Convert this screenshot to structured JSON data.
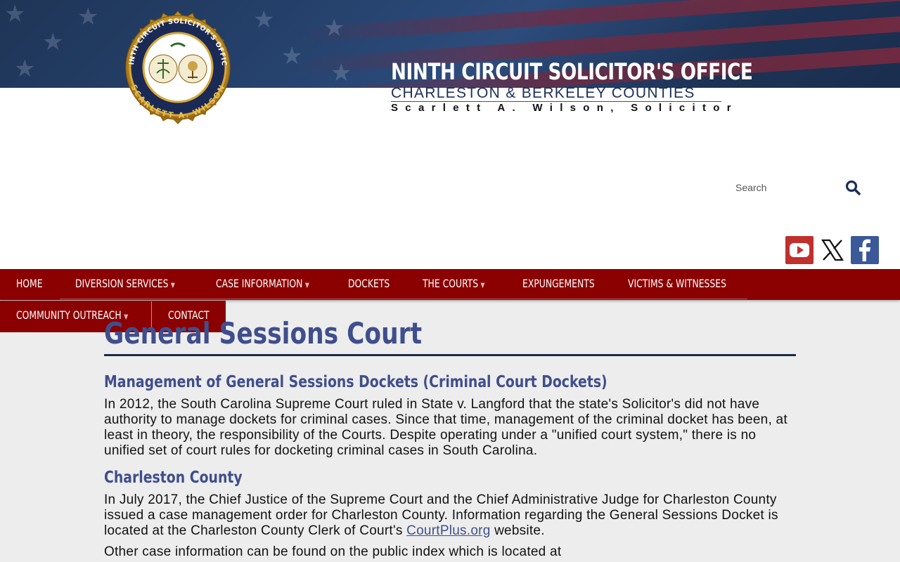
{
  "header": {
    "title": "NINTH CIRCUIT SOLICITOR'S OFFICE",
    "subtitle": "CHARLESTON & BERKELEY COUNTIES",
    "solicitor": "Scarlett A. Wilson, Solicitor",
    "seal": {
      "ring_text_top": "NINTH CIRCUIT SOLICITOR'S OFFICE",
      "ring_text_bottom": "SCARLETT A. WILSON"
    }
  },
  "search": {
    "placeholder": "Search"
  },
  "social": [
    {
      "name": "YouTube",
      "icon": "youtube-icon",
      "color": "#c0302d"
    },
    {
      "name": "X",
      "icon": "x-icon",
      "color": "#111111"
    },
    {
      "name": "Facebook",
      "icon": "facebook-icon",
      "color": "#3b5998"
    }
  ],
  "nav": {
    "items": [
      {
        "label": "HOME",
        "has_dropdown": false
      },
      {
        "label": "DIVERSION SERVICES",
        "has_dropdown": true
      },
      {
        "label": "CASE INFORMATION",
        "has_dropdown": true
      },
      {
        "label": "DOCKETS",
        "has_dropdown": false
      },
      {
        "label": "THE COURTS",
        "has_dropdown": true
      },
      {
        "label": "EXPUNGEMENTS",
        "has_dropdown": false
      },
      {
        "label": "VICTIMS & WITNESSES",
        "has_dropdown": false
      },
      {
        "label": "COMMUNITY OUTREACH",
        "has_dropdown": true
      },
      {
        "label": "CONTACT",
        "has_dropdown": false
      }
    ],
    "caret": "▼"
  },
  "colors": {
    "nav_bg": "#8b0000",
    "heading": "#3f4e8c",
    "banner": "#24406a",
    "page_bg": "#ededed"
  },
  "content": {
    "page_title": "General Sessions Court",
    "section1_heading": "Management of General Sessions Dockets (Criminal Court Dockets)",
    "section1_text": "In 2012, the South Carolina Supreme Court ruled in State v. Langford that the state's Solicitor's did not have authority to manage dockets for criminal cases. Since that time, management of the criminal docket has been, at least in theory, the responsibility of the Courts. Despite operating under a \"unified court system,\" there is no unified set of court rules for docketing criminal cases in South Carolina.",
    "section2_heading": "Charleston County",
    "section2_text_before_link": "In July 2017, the Chief Justice of the Supreme Court and the Chief Administrative Judge for Charleston County issued a case management order for Charleston County. Information regarding the General Sessions Docket is located at the Charleston County Clerk of Court's ",
    "section2_link": "CourtPlus.org",
    "section2_text_after_link": " website.",
    "section3_text": "Other case information can be found on the public index which is located at"
  }
}
